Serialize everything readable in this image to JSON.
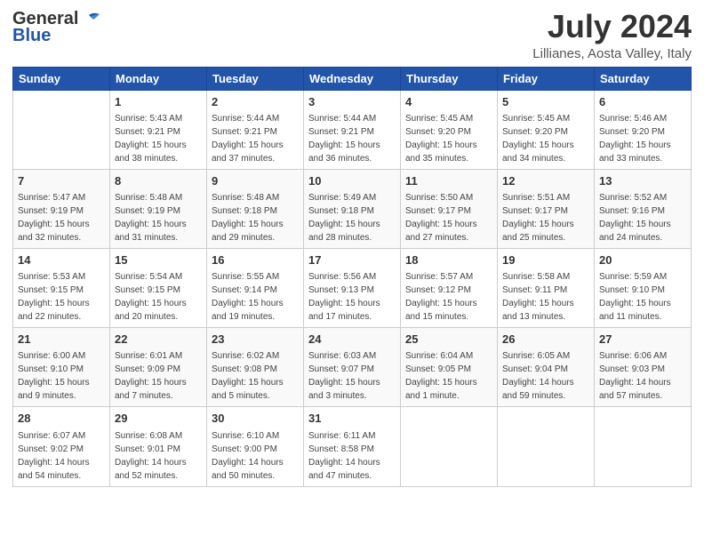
{
  "header": {
    "logo_line1": "General",
    "logo_line2": "Blue",
    "title": "July 2024",
    "subtitle": "Lillianes, Aosta Valley, Italy"
  },
  "calendar": {
    "days_of_week": [
      "Sunday",
      "Monday",
      "Tuesday",
      "Wednesday",
      "Thursday",
      "Friday",
      "Saturday"
    ],
    "weeks": [
      [
        {
          "day": "",
          "info": ""
        },
        {
          "day": "1",
          "info": "Sunrise: 5:43 AM\nSunset: 9:21 PM\nDaylight: 15 hours\nand 38 minutes."
        },
        {
          "day": "2",
          "info": "Sunrise: 5:44 AM\nSunset: 9:21 PM\nDaylight: 15 hours\nand 37 minutes."
        },
        {
          "day": "3",
          "info": "Sunrise: 5:44 AM\nSunset: 9:21 PM\nDaylight: 15 hours\nand 36 minutes."
        },
        {
          "day": "4",
          "info": "Sunrise: 5:45 AM\nSunset: 9:20 PM\nDaylight: 15 hours\nand 35 minutes."
        },
        {
          "day": "5",
          "info": "Sunrise: 5:45 AM\nSunset: 9:20 PM\nDaylight: 15 hours\nand 34 minutes."
        },
        {
          "day": "6",
          "info": "Sunrise: 5:46 AM\nSunset: 9:20 PM\nDaylight: 15 hours\nand 33 minutes."
        }
      ],
      [
        {
          "day": "7",
          "info": "Sunrise: 5:47 AM\nSunset: 9:19 PM\nDaylight: 15 hours\nand 32 minutes."
        },
        {
          "day": "8",
          "info": "Sunrise: 5:48 AM\nSunset: 9:19 PM\nDaylight: 15 hours\nand 31 minutes."
        },
        {
          "day": "9",
          "info": "Sunrise: 5:48 AM\nSunset: 9:18 PM\nDaylight: 15 hours\nand 29 minutes."
        },
        {
          "day": "10",
          "info": "Sunrise: 5:49 AM\nSunset: 9:18 PM\nDaylight: 15 hours\nand 28 minutes."
        },
        {
          "day": "11",
          "info": "Sunrise: 5:50 AM\nSunset: 9:17 PM\nDaylight: 15 hours\nand 27 minutes."
        },
        {
          "day": "12",
          "info": "Sunrise: 5:51 AM\nSunset: 9:17 PM\nDaylight: 15 hours\nand 25 minutes."
        },
        {
          "day": "13",
          "info": "Sunrise: 5:52 AM\nSunset: 9:16 PM\nDaylight: 15 hours\nand 24 minutes."
        }
      ],
      [
        {
          "day": "14",
          "info": "Sunrise: 5:53 AM\nSunset: 9:15 PM\nDaylight: 15 hours\nand 22 minutes."
        },
        {
          "day": "15",
          "info": "Sunrise: 5:54 AM\nSunset: 9:15 PM\nDaylight: 15 hours\nand 20 minutes."
        },
        {
          "day": "16",
          "info": "Sunrise: 5:55 AM\nSunset: 9:14 PM\nDaylight: 15 hours\nand 19 minutes."
        },
        {
          "day": "17",
          "info": "Sunrise: 5:56 AM\nSunset: 9:13 PM\nDaylight: 15 hours\nand 17 minutes."
        },
        {
          "day": "18",
          "info": "Sunrise: 5:57 AM\nSunset: 9:12 PM\nDaylight: 15 hours\nand 15 minutes."
        },
        {
          "day": "19",
          "info": "Sunrise: 5:58 AM\nSunset: 9:11 PM\nDaylight: 15 hours\nand 13 minutes."
        },
        {
          "day": "20",
          "info": "Sunrise: 5:59 AM\nSunset: 9:10 PM\nDaylight: 15 hours\nand 11 minutes."
        }
      ],
      [
        {
          "day": "21",
          "info": "Sunrise: 6:00 AM\nSunset: 9:10 PM\nDaylight: 15 hours\nand 9 minutes."
        },
        {
          "day": "22",
          "info": "Sunrise: 6:01 AM\nSunset: 9:09 PM\nDaylight: 15 hours\nand 7 minutes."
        },
        {
          "day": "23",
          "info": "Sunrise: 6:02 AM\nSunset: 9:08 PM\nDaylight: 15 hours\nand 5 minutes."
        },
        {
          "day": "24",
          "info": "Sunrise: 6:03 AM\nSunset: 9:07 PM\nDaylight: 15 hours\nand 3 minutes."
        },
        {
          "day": "25",
          "info": "Sunrise: 6:04 AM\nSunset: 9:05 PM\nDaylight: 15 hours\nand 1 minute."
        },
        {
          "day": "26",
          "info": "Sunrise: 6:05 AM\nSunset: 9:04 PM\nDaylight: 14 hours\nand 59 minutes."
        },
        {
          "day": "27",
          "info": "Sunrise: 6:06 AM\nSunset: 9:03 PM\nDaylight: 14 hours\nand 57 minutes."
        }
      ],
      [
        {
          "day": "28",
          "info": "Sunrise: 6:07 AM\nSunset: 9:02 PM\nDaylight: 14 hours\nand 54 minutes."
        },
        {
          "day": "29",
          "info": "Sunrise: 6:08 AM\nSunset: 9:01 PM\nDaylight: 14 hours\nand 52 minutes."
        },
        {
          "day": "30",
          "info": "Sunrise: 6:10 AM\nSunset: 9:00 PM\nDaylight: 14 hours\nand 50 minutes."
        },
        {
          "day": "31",
          "info": "Sunrise: 6:11 AM\nSunset: 8:58 PM\nDaylight: 14 hours\nand 47 minutes."
        },
        {
          "day": "",
          "info": ""
        },
        {
          "day": "",
          "info": ""
        },
        {
          "day": "",
          "info": ""
        }
      ]
    ]
  }
}
